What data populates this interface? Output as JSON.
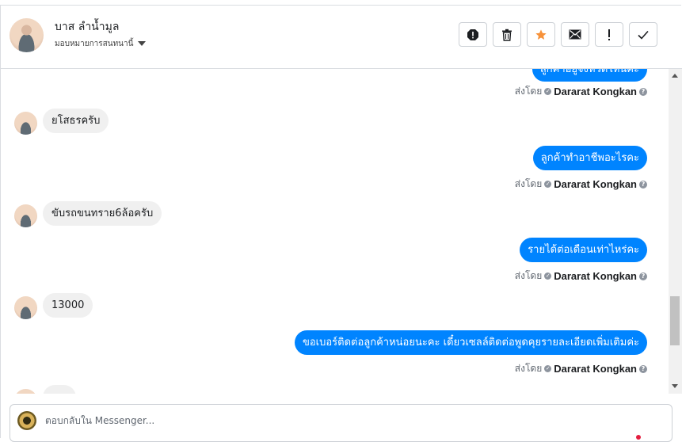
{
  "header": {
    "user_name": "บาส ลำน้ำมูล",
    "assign_label": "มอบหมายการสนทนานี้",
    "actions": [
      {
        "name": "spam-icon",
        "glyph": "!"
      },
      {
        "name": "trash-icon",
        "glyph": ""
      },
      {
        "name": "star-icon",
        "glyph": "★"
      },
      {
        "name": "mail-icon",
        "glyph": "✉"
      },
      {
        "name": "follow-up-icon",
        "glyph": "!"
      },
      {
        "name": "done-icon",
        "glyph": "✓"
      }
    ]
  },
  "colors": {
    "outgoing_bubble": "#0084ff",
    "incoming_bubble": "#f0f0f0",
    "star": "#f7923a"
  },
  "thread": {
    "sent_by_label": "ส่งโดย",
    "agent_name": "Dararat Kongkan",
    "messages": [
      {
        "dir": "out",
        "text": "ลูกค้าอยู่จังหวัดไหนคะ"
      },
      {
        "dir": "in",
        "text": "ยโสธรครับ"
      },
      {
        "dir": "out",
        "text": "ลูกค้าทำอาชีพอะไรคะ"
      },
      {
        "dir": "in",
        "text": "ขับรถขนทราย6ล้อครับ"
      },
      {
        "dir": "out",
        "text": "รายได้ต่อเดือนเท่าไหร่คะ"
      },
      {
        "dir": "in",
        "text": "13000"
      },
      {
        "dir": "out",
        "text": "ขอเบอร์ติดต่อลูกค้าหน่อยนะคะ เดี๋ยวเซลล์ติดต่อพูดคุยรายละเอียดเพิ่มเติมค่ะ"
      }
    ]
  },
  "composer": {
    "placeholder": "ตอบกลับใน Messenger..."
  }
}
